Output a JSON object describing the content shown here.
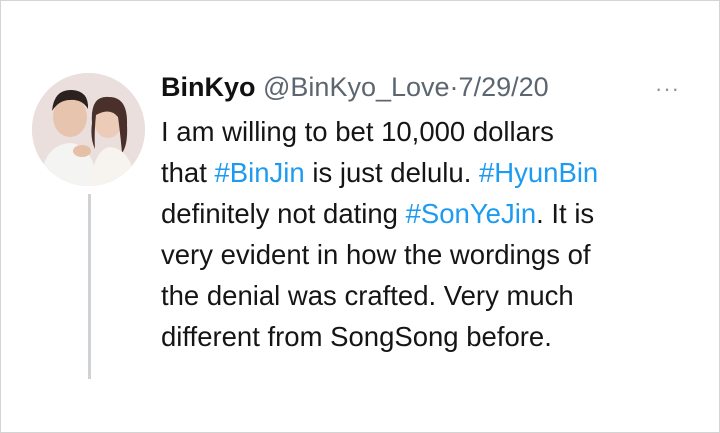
{
  "tweet": {
    "display_name": "BinKyo",
    "handle": "@BinKyo_Love",
    "separator": "·",
    "date": "7/29/20",
    "more_icon": "···",
    "lines": [
      [
        "I am willing to bet 10,000 dollars"
      ],
      [
        "that ",
        "#BinJin",
        " is just delulu. ",
        "#HyunBin"
      ],
      [
        "definitely not dating ",
        "#SonYeJin",
        ". It is"
      ],
      [
        "very evident in how the wordings of"
      ],
      [
        "the denial was crafted. Very much"
      ],
      [
        "different from SongSong before."
      ]
    ]
  },
  "colors": {
    "hashtag": "#1d9bf0",
    "meta": "#5c6670",
    "thread_line": "#cfd3d6"
  }
}
